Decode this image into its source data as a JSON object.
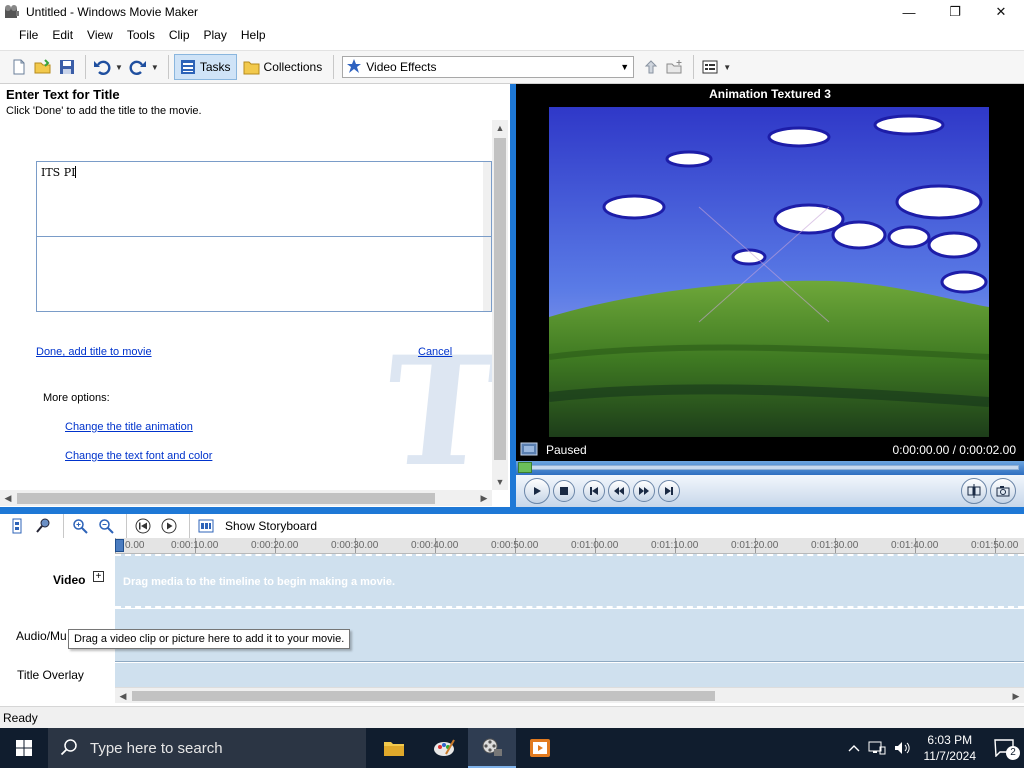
{
  "window": {
    "title": "Untitled - Windows Movie Maker",
    "minimize_glyph": "—",
    "maximize_glyph": "❐",
    "close_glyph": "✕"
  },
  "menu": [
    "File",
    "Edit",
    "View",
    "Tools",
    "Clip",
    "Play",
    "Help"
  ],
  "toolbar": {
    "tasks_label": "Tasks",
    "collections_label": "Collections",
    "effects_value": "Video Effects"
  },
  "task_pane": {
    "title": "Enter Text for Title",
    "hint": "Click 'Done' to add the title to the movie.",
    "title_text": "ITS PI",
    "watermark": "T",
    "done_link": "Done, add title to movie",
    "cancel_link": "Cancel",
    "more_options": "More options:",
    "option_animation": "Change the title animation",
    "option_font": "Change the text font and color"
  },
  "preview": {
    "title": "Animation Textured 3",
    "state": "Paused",
    "time": "0:00:00.00 / 0:00:02.00"
  },
  "timeline": {
    "show_storyboard": "Show Storyboard",
    "ruler_ticks": [
      "0.00",
      "0:00:10.00",
      "0:00:20.00",
      "0:00:30.00",
      "0:00:40.00",
      "0:00:50.00",
      "0:01:00.00",
      "0:01:10.00",
      "0:01:20.00",
      "0:01:30.00",
      "0:01:40.00",
      "0:01:50.00"
    ],
    "track_video": "Video",
    "track_audio": "Audio/Mu",
    "track_title": "Title Overlay",
    "video_hint": "Drag media to the timeline to begin making a movie.",
    "tooltip": "Drag a video clip or picture here to add it to your movie."
  },
  "status": "Ready",
  "taskbar": {
    "search_placeholder": "Type here to search",
    "time": "6:03 PM",
    "date": "11/7/2024",
    "notification_count": "2"
  },
  "colors": {
    "accent": "#1e78d6",
    "link": "#0033cc",
    "timeline_track": "#cfe0ee",
    "taskbar": "#101d2e"
  }
}
